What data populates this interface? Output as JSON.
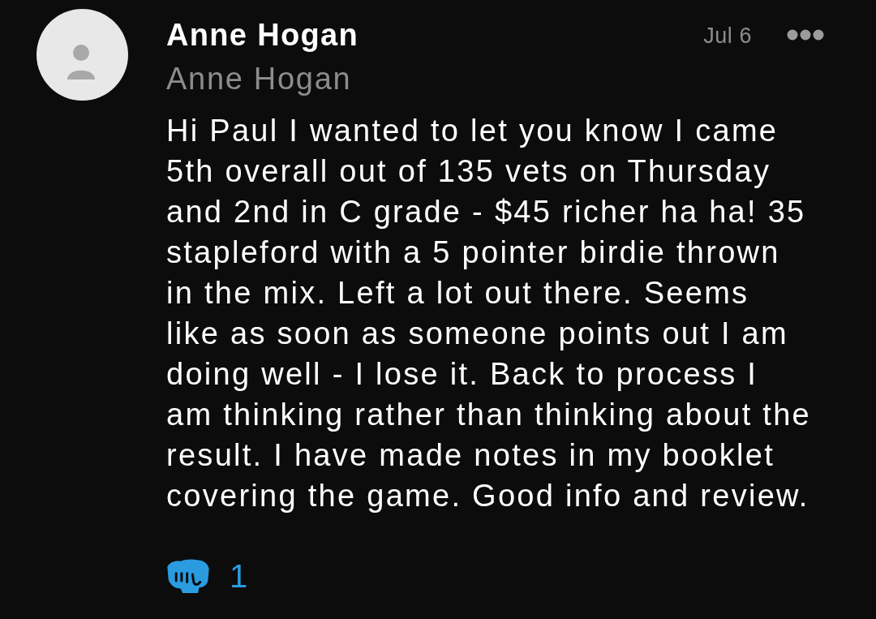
{
  "post": {
    "author": {
      "name": "Anne Hogan",
      "handle": "Anne Hogan"
    },
    "date": "Jul 6",
    "body": "Hi Paul I wanted to let you know I came 5th overall out of 135 vets on Thursday and 2nd in C grade - $45 richer ha ha! 35 stapleford with a 5 pointer birdie thrown in the mix. Left a lot out there. Seems like as soon as someone points out I am doing well - I lose it. Back to process I am thinking rather than thinking about the result. I have made notes in my booklet covering the game. Good info and review.",
    "reactions": [
      {
        "count": "1"
      }
    ]
  }
}
